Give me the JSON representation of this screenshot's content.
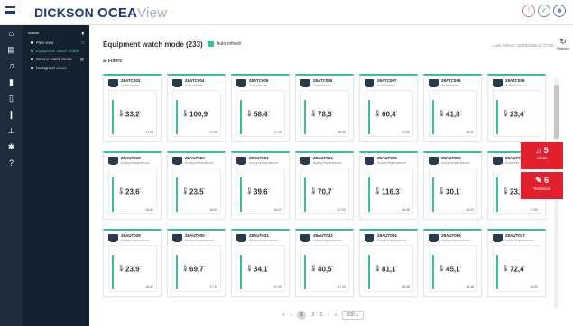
{
  "brand": {
    "part1": "DICKSON",
    "part2": "OCEA",
    "part3": "View"
  },
  "menu": {
    "title": "ocean",
    "items": [
      {
        "label": "Plan view",
        "active": false
      },
      {
        "label": "Equipment watch mode",
        "active": true
      },
      {
        "label": "Sensor watch mode",
        "active": false
      },
      {
        "label": "Multigraph views",
        "active": false
      }
    ]
  },
  "header": {
    "title": "Equipment watch mode (233)",
    "auto_refresh": "Auto refresh",
    "last_refresh": "Last refresh: 02/04/2020 at 17:00",
    "refresh": "Refresh",
    "filters": "Filters"
  },
  "cards": [
    {
      "id": "28ATC003",
      "type": "Autoclaves",
      "value": "33,2",
      "unit": "°",
      "time": "17:09"
    },
    {
      "id": "28ATC004",
      "type": "Autoclaves",
      "value": "100,9",
      "unit": "°",
      "time": "17:08"
    },
    {
      "id": "28ATC005",
      "type": "Autoclaves",
      "value": "58,4",
      "unit": "°",
      "time": "17:13"
    },
    {
      "id": "28ATC006",
      "type": "Autoclaves",
      "value": "78,3",
      "unit": "°",
      "time": "16:49"
    },
    {
      "id": "28ATC007",
      "type": "Autoclaves",
      "value": "60,4",
      "unit": "°",
      "time": "17:00"
    },
    {
      "id": "28ATC008",
      "type": "Autoclaves",
      "value": "41,8",
      "unit": "°",
      "time": "16:41"
    },
    {
      "id": "28ATC009",
      "type": "Autoclaves",
      "value": "23,4",
      "unit": "°",
      "time": ""
    },
    {
      "id": "28AUT019",
      "type": "Autoprélparateurs",
      "value": "23,6",
      "unit": "°",
      "time": "16:52"
    },
    {
      "id": "28AUT020",
      "type": "Autoprélparateurs",
      "value": "23,5",
      "unit": "°",
      "time": "16:53"
    },
    {
      "id": "28AUT021",
      "type": "Autoprélparateurs",
      "value": "39,6",
      "unit": "°",
      "time": "16:47"
    },
    {
      "id": "28AUT024",
      "type": "Autoprélparateurs",
      "value": "70,7",
      "unit": "°",
      "time": "17:00"
    },
    {
      "id": "28AUT025",
      "type": "Autoprélparateurs",
      "value": "116,3",
      "unit": "°",
      "time": "16:45"
    },
    {
      "id": "28AUT026",
      "type": "Autoprélparateurs",
      "value": "30,1",
      "unit": "°",
      "time": "16:52"
    },
    {
      "id": "28AUT02",
      "type": "Autoprél",
      "value": "23,",
      "unit": "",
      "time": "17:05"
    },
    {
      "id": "28AUT029",
      "type": "Autoprélparateurs",
      "value": "23,9",
      "unit": "°",
      "time": "16:47"
    },
    {
      "id": "28AUT030",
      "type": "Autoprélparateurs",
      "value": "69,7",
      "unit": "°",
      "time": "17:13"
    },
    {
      "id": "28AUT031",
      "type": "Autoprélparateurs",
      "value": "34,1",
      "unit": "°",
      "time": "17:00"
    },
    {
      "id": "28AUT032",
      "type": "Autoprélparateurs",
      "value": "40,5",
      "unit": "°",
      "time": "17:14"
    },
    {
      "id": "28AUT034",
      "type": "Autoprélparateurs",
      "value": "81,1",
      "unit": "°",
      "time": "16:55"
    },
    {
      "id": "28AUT036",
      "type": "Autoprélparateurs",
      "value": "45,1",
      "unit": "°",
      "time": "16:46"
    },
    {
      "id": "28AUT037",
      "type": "Autoprélparateurs",
      "value": "72,4",
      "unit": "°",
      "time": "16:52"
    }
  ],
  "pager": {
    "first": "«",
    "prev": "‹",
    "p1": "1",
    "p2": "2",
    "p3": "3",
    "next": "›",
    "last": "»",
    "per_page": "100"
  },
  "alerts": [
    {
      "count": "5",
      "label": "Limits",
      "icon": "bell-icon",
      "color": "#e21f2d"
    },
    {
      "count": "6",
      "label": "Technical",
      "icon": "wrench-icon",
      "color": "#e21f2d"
    }
  ],
  "colors": {
    "accent": "#3bbf9a",
    "sidebar": "#14212e",
    "alert": "#e21f2d",
    "brand": "#1f3b73"
  }
}
